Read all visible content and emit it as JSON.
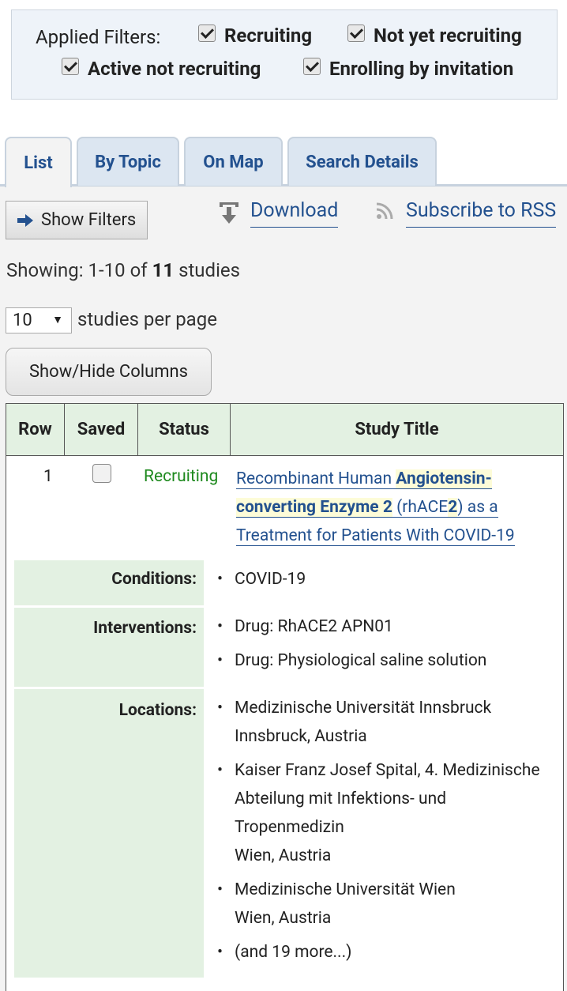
{
  "applied_filters": {
    "label": "Applied Filters:",
    "items": [
      {
        "label": "Recruiting",
        "checked": true
      },
      {
        "label": "Not yet recruiting",
        "checked": true
      },
      {
        "label": "Active not recruiting",
        "checked": true
      },
      {
        "label": "Enrolling by invitation",
        "checked": true
      }
    ]
  },
  "tabs": [
    {
      "label": "List",
      "active": true
    },
    {
      "label": "By Topic",
      "active": false
    },
    {
      "label": "On Map",
      "active": false
    },
    {
      "label": "Search Details",
      "active": false
    }
  ],
  "toolbar": {
    "show_filters_label": "Show Filters",
    "download_label": "Download",
    "rss_label": "Subscribe to RSS"
  },
  "results": {
    "showing_prefix": "Showing: 1-10 of ",
    "total": "11",
    "showing_suffix": " studies",
    "per_page_value": "10",
    "per_page_label": "studies per page",
    "show_hide_columns_label": "Show/Hide Columns"
  },
  "table": {
    "headers": [
      "Row",
      "Saved",
      "Status",
      "Study Title"
    ],
    "rows": [
      {
        "row": "1",
        "saved": false,
        "status": "Recruiting",
        "title_parts": [
          "Recombinant Human ",
          "Angiotensin-converting Enzyme 2",
          " (rhACE",
          "2",
          ") as a Treatment for Patients With COVID-19"
        ],
        "conditions_label": "Conditions:",
        "conditions": [
          "COVID-19"
        ],
        "interventions_label": "Interventions:",
        "interventions": [
          "Drug: RhACE2 APN01",
          "Drug: Physiological saline solution"
        ],
        "locations_label": "Locations:",
        "locations": [
          {
            "name": "Medizinische Universität Innsbruck",
            "city": "Innsbruck, Austria"
          },
          {
            "name": "Kaiser Franz Josef Spital, 4. Medizinische Abteilung mit Infektions- und Tropenmedizin",
            "city": "Wien, Austria"
          },
          {
            "name": "Medizinische Universität Wien",
            "city": "Wien, Austria"
          }
        ],
        "more_locations": "(and 19 more...)"
      }
    ]
  },
  "colors": {
    "link": "#23518f",
    "status_recruiting": "#1f8a1f",
    "header_bg": "#e3f1e2",
    "filters_bg": "#eef3f9"
  }
}
